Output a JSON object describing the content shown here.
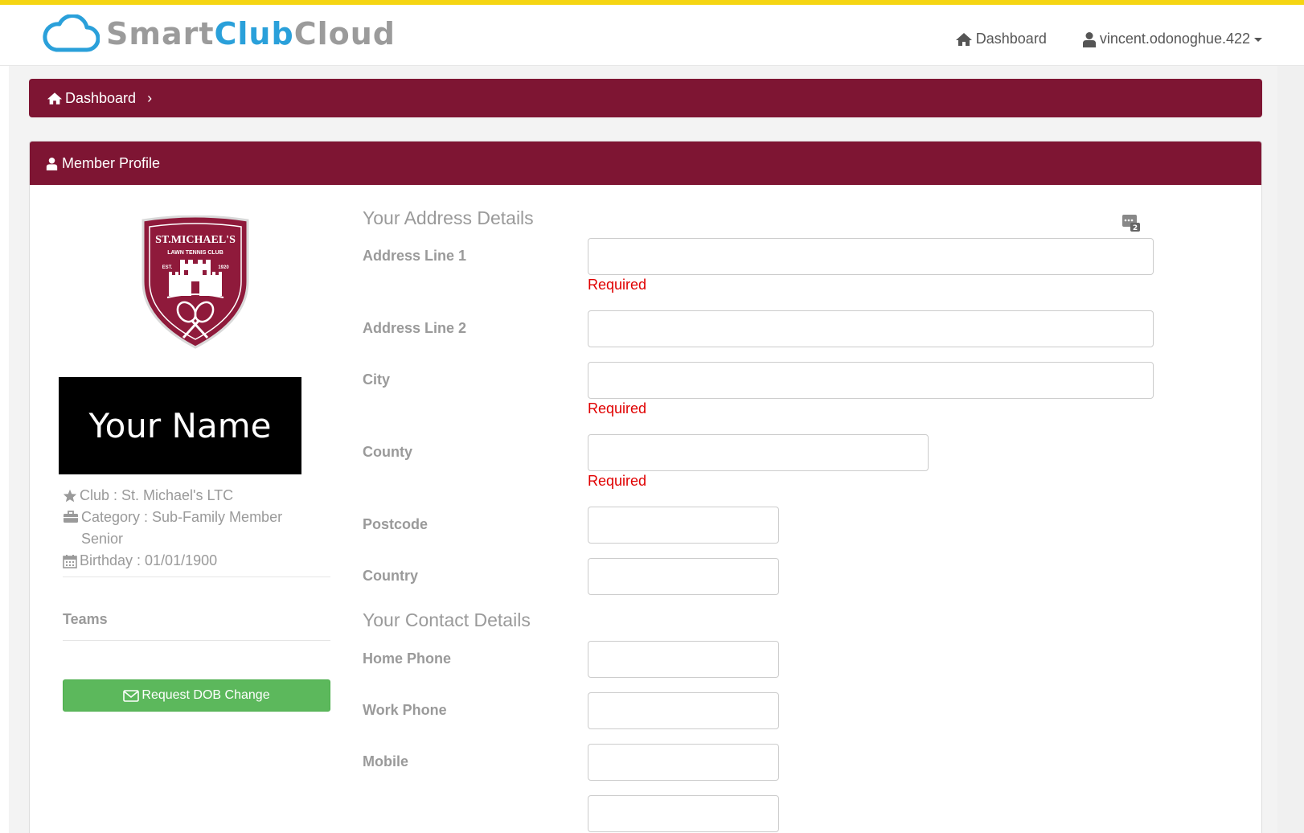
{
  "header": {
    "brand": {
      "smart": "Smart",
      "club": "Club",
      "cloud": "Cloud"
    },
    "nav": {
      "dashboard_label": "Dashboard",
      "user_label": "vincent.odonoghue.422"
    }
  },
  "breadcrumb": {
    "home_label": "Dashboard",
    "separator": "›"
  },
  "panel": {
    "title": "Member Profile",
    "profile": {
      "name_display": "Your Name",
      "club_line": "Club : St. Michael's LTC",
      "category_line": "Category : Sub-Family Member Senior",
      "birthday_line": "Birthday : 01/01/1900",
      "teams_label": "Teams",
      "dob_button_label": "Request DOB Change"
    },
    "logo": {
      "club_name": "ST.MICHAEL'S",
      "subtitle": "LAWN TENNIS CLUB",
      "est": "EST.",
      "year": "1920"
    },
    "address": {
      "title": "Your Address Details",
      "fields": [
        {
          "label": "Address Line 1",
          "value": "",
          "error": "Required"
        },
        {
          "label": "Address Line 2",
          "value": ""
        },
        {
          "label": "City",
          "value": "",
          "error": "Required"
        },
        {
          "label": "County",
          "value": "",
          "error": "Required"
        },
        {
          "label": "Postcode",
          "value": ""
        },
        {
          "label": "Country",
          "value": ""
        }
      ]
    },
    "contact": {
      "title": "Your Contact Details",
      "fields": [
        {
          "label": "Home Phone",
          "value": ""
        },
        {
          "label": "Work Phone",
          "value": ""
        },
        {
          "label": "Mobile",
          "value": ""
        }
      ]
    }
  },
  "colors": {
    "accent_bar": "#f5d512",
    "maroon": "#7e1533",
    "brand_blue": "#2aa0da",
    "success_green": "#5cb85c",
    "error_red": "#e00000"
  }
}
